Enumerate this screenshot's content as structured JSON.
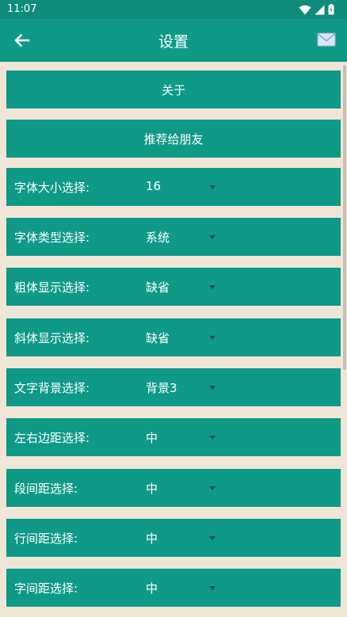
{
  "status": {
    "time": "11:07"
  },
  "appbar": {
    "title": "设置",
    "back_icon": "arrow-left-icon",
    "mail_icon": "envelope-icon"
  },
  "buttons": {
    "about": "关于",
    "recommend": "推荐给朋友"
  },
  "settings": [
    {
      "label": "字体大小选择:",
      "value": "16"
    },
    {
      "label": "字体类型选择:",
      "value": "系统"
    },
    {
      "label": "粗体显示选择:",
      "value": "缺省"
    },
    {
      "label": "斜体显示选择:",
      "value": "缺省"
    },
    {
      "label": "文字背景选择:",
      "value": "背景3"
    },
    {
      "label": "左右边距选择:",
      "value": "中"
    },
    {
      "label": "段间距选择:",
      "value": "中"
    },
    {
      "label": "行间距选择:",
      "value": "中"
    },
    {
      "label": "字间距选择:",
      "value": "中"
    }
  ],
  "colors": {
    "primary": "#0f9a87",
    "statusbar": "#0f8b79",
    "background": "#efe6d8",
    "arrow": "#1d4d46"
  }
}
